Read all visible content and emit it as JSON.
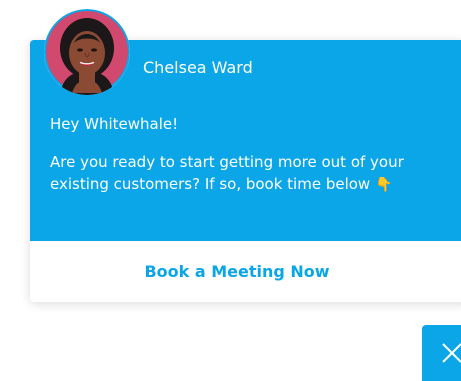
{
  "chat": {
    "sender_name": "Chelsea Ward",
    "greeting": "Hey Whitewhale!",
    "message": "Are you ready to start getting more out of your existing customers? If so, book time below",
    "emoji": "👇",
    "cta_label": "Book a Meeting Now"
  },
  "colors": {
    "accent": "#0aa6e8",
    "text_on_accent": "#ffffff",
    "card_bg": "#ffffff"
  },
  "icons": {
    "avatar": "avatar",
    "close": "close-icon",
    "pointing_down": "pointing-down-hand-icon"
  }
}
